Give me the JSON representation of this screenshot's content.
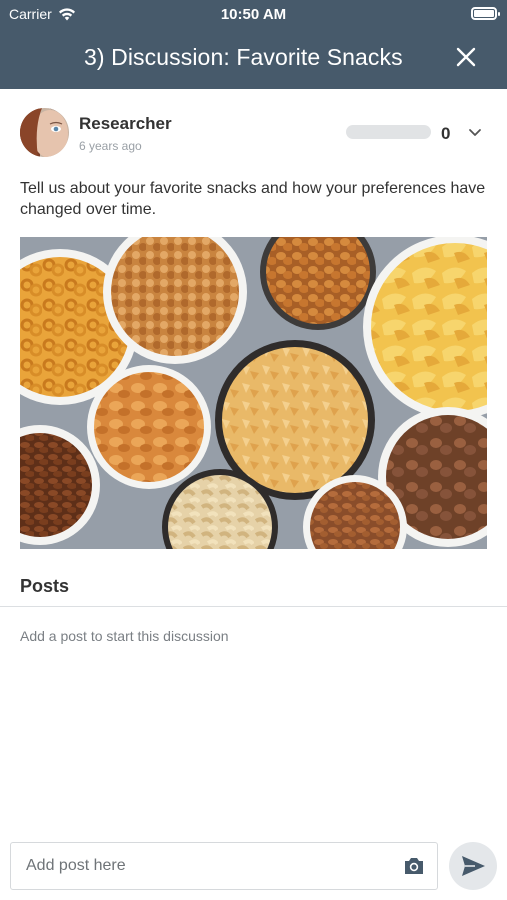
{
  "status_bar": {
    "carrier": "Carrier",
    "time": "10:50 AM"
  },
  "header": {
    "title": "3) Discussion: Favorite Snacks",
    "close_icon": "close-icon",
    "background_color": "#475a6b"
  },
  "author": {
    "name": "Researcher",
    "timestamp": "6 years ago",
    "count": "0",
    "expand_icon": "chevron-down-icon"
  },
  "discussion": {
    "prompt": "Tell us about your favorite snacks and how your preferences have changed over time."
  },
  "posts": {
    "heading": "Posts",
    "empty_message": "Add a post to start this discussion"
  },
  "composer": {
    "placeholder": "Add post here",
    "value": "",
    "camera_icon": "camera-icon",
    "send_icon": "send-icon"
  }
}
